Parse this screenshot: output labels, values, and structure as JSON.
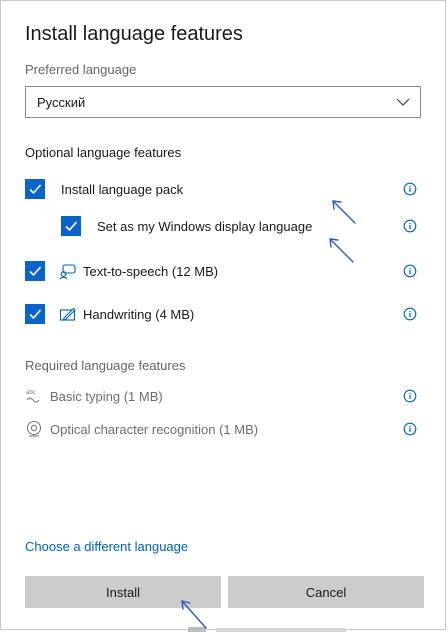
{
  "dialog": {
    "title": "Install language features",
    "preferred_label": "Preferred language",
    "preferred_value": "Русский",
    "optional_header": "Optional language features",
    "optional_items": [
      {
        "label": "Install language pack",
        "checked": true,
        "indent": 0
      },
      {
        "label": "Set as my Windows display language",
        "checked": true,
        "indent": 1
      },
      {
        "label": "Text-to-speech (12 MB)",
        "checked": true,
        "icon": "speech-icon"
      },
      {
        "label": "Handwriting (4 MB)",
        "checked": true,
        "icon": "handwriting-icon"
      }
    ],
    "required_header": "Required language features",
    "required_items": [
      {
        "label": "Basic typing (1 MB)",
        "icon": "typing-icon"
      },
      {
        "label": "Optical character recognition (1 MB)",
        "icon": "ocr-icon"
      }
    ],
    "choose_link": "Choose a different language",
    "install_button": "Install",
    "cancel_button": "Cancel"
  },
  "colors": {
    "accent": "#0a64c8",
    "link": "#0063b1",
    "button_bg": "#cccccc",
    "annotation_arrow": "#2f5db8"
  }
}
